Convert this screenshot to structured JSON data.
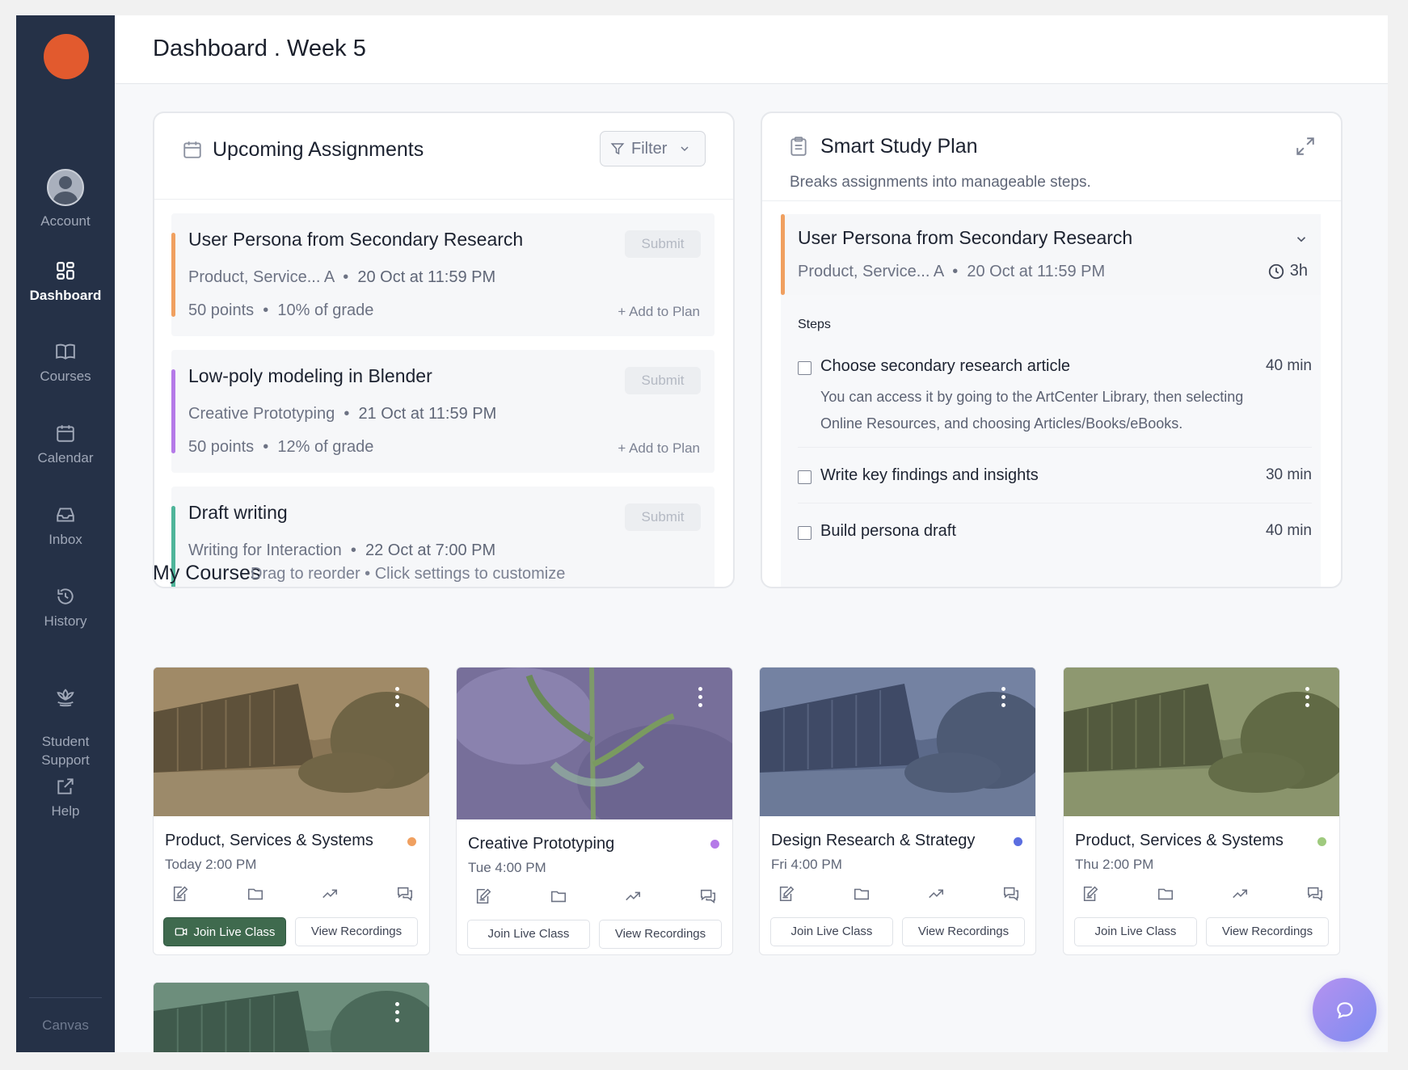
{
  "header": {
    "title": "Dashboard . Week 5"
  },
  "sidebar": {
    "items": [
      {
        "label": "Account",
        "icon": "account-icon"
      },
      {
        "label": "Dashboard",
        "icon": "dashboard-icon",
        "active": true
      },
      {
        "label": "Courses",
        "icon": "book-icon"
      },
      {
        "label": "Calendar",
        "icon": "calendar-icon"
      },
      {
        "label": "Inbox",
        "icon": "inbox-icon"
      },
      {
        "label": "History",
        "icon": "history-icon"
      },
      {
        "label": "Student\nSupport",
        "icon": "lotus-icon"
      },
      {
        "label": "Help",
        "icon": "external-link-icon"
      }
    ],
    "footer": "Canvas"
  },
  "assignments": {
    "title": "Upcoming Assignments",
    "filter_label": "Filter",
    "items": [
      {
        "title": "User Persona from Secondary Research",
        "course": "Product, Service... A",
        "due": "20 Oct at 11:59 PM",
        "points": "50 points",
        "grade": "10% of grade",
        "submit": "Submit",
        "add": "+ Add to Plan",
        "color": "#f0a060"
      },
      {
        "title": "Low-poly modeling in Blender",
        "course": "Creative Prototyping",
        "due": "21 Oct at 11:59 PM",
        "points": "50 points",
        "grade": "12% of grade",
        "submit": "Submit",
        "add": "+ Add to Plan",
        "color": "#b57ae8"
      },
      {
        "title": "Draft writing",
        "course": "Writing for Interaction",
        "due": "22 Oct at 7:00 PM",
        "submit": "Submit",
        "color": "#4fb59a"
      }
    ]
  },
  "study_plan": {
    "title": "Smart Study Plan",
    "subtitle": "Breaks assignments into manageable steps.",
    "item": {
      "title": "User Persona from Secondary Research",
      "course": "Product, Service... A",
      "due": "20 Oct at 11:59 PM",
      "duration": "3h",
      "color": "#f0a060"
    },
    "steps_label": "Steps",
    "steps": [
      {
        "title": "Choose secondary research article",
        "duration": "40 min",
        "desc": "You can access it by going to the ArtCenter Library, then selecting Online Resources, and choosing Articles/Books/eBooks."
      },
      {
        "title": "Write key findings and insights",
        "duration": "30 min"
      },
      {
        "title": "Build persona draft",
        "duration": "40 min"
      }
    ]
  },
  "courses": {
    "title": "My Courses",
    "subtitle": "Drag to reorder • Click settings to customize",
    "join_label": "Join Live Class",
    "recordings_label": "View Recordings",
    "items": [
      {
        "name": "Product, Services & Systems",
        "time": "Today 2:00 PM",
        "color": "#f0a060",
        "live": true
      },
      {
        "name": "Creative Prototyping",
        "time": "Tue 4:00 PM",
        "color": "#b57ae8"
      },
      {
        "name": "Design Research & Strategy",
        "time": "Fri 4:00 PM",
        "color": "#5b6ee0"
      },
      {
        "name": "Product, Services & Systems",
        "time": "Thu 2:00 PM",
        "color": "#9fca7e"
      }
    ]
  },
  "chat_button": {
    "icon": "chat-bubble-icon"
  }
}
